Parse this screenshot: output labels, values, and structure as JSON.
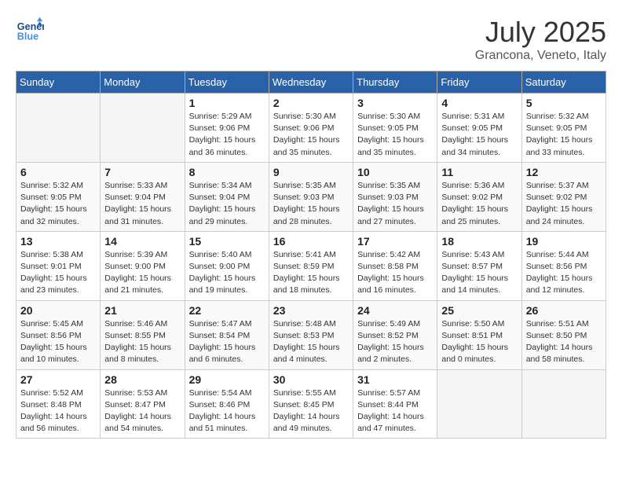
{
  "header": {
    "logo_line1": "General",
    "logo_line2": "Blue",
    "month": "July 2025",
    "location": "Grancona, Veneto, Italy"
  },
  "days_of_week": [
    "Sunday",
    "Monday",
    "Tuesday",
    "Wednesday",
    "Thursday",
    "Friday",
    "Saturday"
  ],
  "weeks": [
    [
      {
        "day": "",
        "info": ""
      },
      {
        "day": "",
        "info": ""
      },
      {
        "day": "1",
        "info": "Sunrise: 5:29 AM\nSunset: 9:06 PM\nDaylight: 15 hours\nand 36 minutes."
      },
      {
        "day": "2",
        "info": "Sunrise: 5:30 AM\nSunset: 9:06 PM\nDaylight: 15 hours\nand 35 minutes."
      },
      {
        "day": "3",
        "info": "Sunrise: 5:30 AM\nSunset: 9:05 PM\nDaylight: 15 hours\nand 35 minutes."
      },
      {
        "day": "4",
        "info": "Sunrise: 5:31 AM\nSunset: 9:05 PM\nDaylight: 15 hours\nand 34 minutes."
      },
      {
        "day": "5",
        "info": "Sunrise: 5:32 AM\nSunset: 9:05 PM\nDaylight: 15 hours\nand 33 minutes."
      }
    ],
    [
      {
        "day": "6",
        "info": "Sunrise: 5:32 AM\nSunset: 9:05 PM\nDaylight: 15 hours\nand 32 minutes."
      },
      {
        "day": "7",
        "info": "Sunrise: 5:33 AM\nSunset: 9:04 PM\nDaylight: 15 hours\nand 31 minutes."
      },
      {
        "day": "8",
        "info": "Sunrise: 5:34 AM\nSunset: 9:04 PM\nDaylight: 15 hours\nand 29 minutes."
      },
      {
        "day": "9",
        "info": "Sunrise: 5:35 AM\nSunset: 9:03 PM\nDaylight: 15 hours\nand 28 minutes."
      },
      {
        "day": "10",
        "info": "Sunrise: 5:35 AM\nSunset: 9:03 PM\nDaylight: 15 hours\nand 27 minutes."
      },
      {
        "day": "11",
        "info": "Sunrise: 5:36 AM\nSunset: 9:02 PM\nDaylight: 15 hours\nand 25 minutes."
      },
      {
        "day": "12",
        "info": "Sunrise: 5:37 AM\nSunset: 9:02 PM\nDaylight: 15 hours\nand 24 minutes."
      }
    ],
    [
      {
        "day": "13",
        "info": "Sunrise: 5:38 AM\nSunset: 9:01 PM\nDaylight: 15 hours\nand 23 minutes."
      },
      {
        "day": "14",
        "info": "Sunrise: 5:39 AM\nSunset: 9:00 PM\nDaylight: 15 hours\nand 21 minutes."
      },
      {
        "day": "15",
        "info": "Sunrise: 5:40 AM\nSunset: 9:00 PM\nDaylight: 15 hours\nand 19 minutes."
      },
      {
        "day": "16",
        "info": "Sunrise: 5:41 AM\nSunset: 8:59 PM\nDaylight: 15 hours\nand 18 minutes."
      },
      {
        "day": "17",
        "info": "Sunrise: 5:42 AM\nSunset: 8:58 PM\nDaylight: 15 hours\nand 16 minutes."
      },
      {
        "day": "18",
        "info": "Sunrise: 5:43 AM\nSunset: 8:57 PM\nDaylight: 15 hours\nand 14 minutes."
      },
      {
        "day": "19",
        "info": "Sunrise: 5:44 AM\nSunset: 8:56 PM\nDaylight: 15 hours\nand 12 minutes."
      }
    ],
    [
      {
        "day": "20",
        "info": "Sunrise: 5:45 AM\nSunset: 8:56 PM\nDaylight: 15 hours\nand 10 minutes."
      },
      {
        "day": "21",
        "info": "Sunrise: 5:46 AM\nSunset: 8:55 PM\nDaylight: 15 hours\nand 8 minutes."
      },
      {
        "day": "22",
        "info": "Sunrise: 5:47 AM\nSunset: 8:54 PM\nDaylight: 15 hours\nand 6 minutes."
      },
      {
        "day": "23",
        "info": "Sunrise: 5:48 AM\nSunset: 8:53 PM\nDaylight: 15 hours\nand 4 minutes."
      },
      {
        "day": "24",
        "info": "Sunrise: 5:49 AM\nSunset: 8:52 PM\nDaylight: 15 hours\nand 2 minutes."
      },
      {
        "day": "25",
        "info": "Sunrise: 5:50 AM\nSunset: 8:51 PM\nDaylight: 15 hours\nand 0 minutes."
      },
      {
        "day": "26",
        "info": "Sunrise: 5:51 AM\nSunset: 8:50 PM\nDaylight: 14 hours\nand 58 minutes."
      }
    ],
    [
      {
        "day": "27",
        "info": "Sunrise: 5:52 AM\nSunset: 8:48 PM\nDaylight: 14 hours\nand 56 minutes."
      },
      {
        "day": "28",
        "info": "Sunrise: 5:53 AM\nSunset: 8:47 PM\nDaylight: 14 hours\nand 54 minutes."
      },
      {
        "day": "29",
        "info": "Sunrise: 5:54 AM\nSunset: 8:46 PM\nDaylight: 14 hours\nand 51 minutes."
      },
      {
        "day": "30",
        "info": "Sunrise: 5:55 AM\nSunset: 8:45 PM\nDaylight: 14 hours\nand 49 minutes."
      },
      {
        "day": "31",
        "info": "Sunrise: 5:57 AM\nSunset: 8:44 PM\nDaylight: 14 hours\nand 47 minutes."
      },
      {
        "day": "",
        "info": ""
      },
      {
        "day": "",
        "info": ""
      }
    ]
  ]
}
